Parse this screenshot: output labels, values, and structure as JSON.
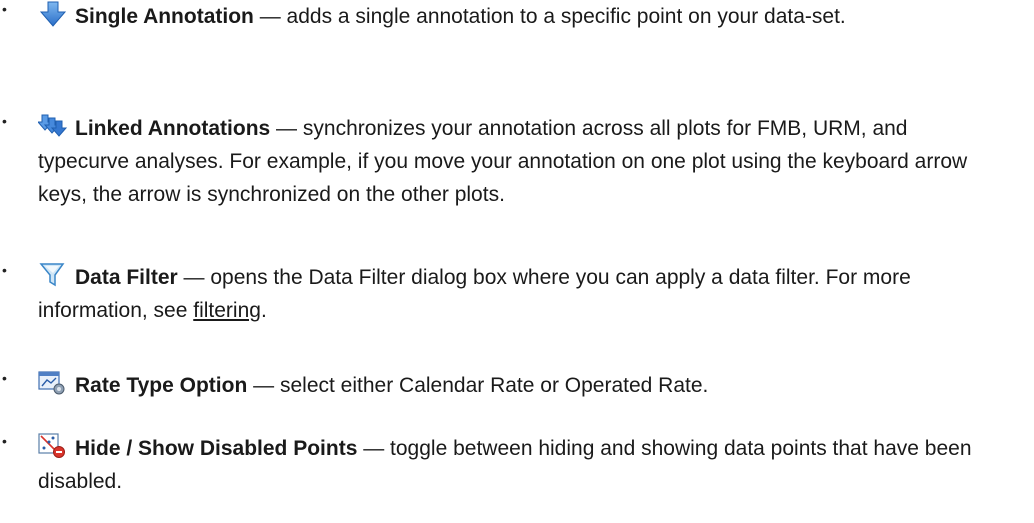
{
  "items": [
    {
      "icon": "down-arrow-icon",
      "term": "Single Annotation",
      "sep": " — ",
      "desc": "adds a single annotation to a specific point on your data-set."
    },
    {
      "icon": "linked-arrows-icon",
      "term": "Linked Annotations",
      "sep": " — ",
      "desc": "synchronizes your annotation across all plots for FMB, URM, and typecurve analyses. For example, if you move your annotation on one plot using the keyboard arrow keys, the arrow is synchronized on the other plots."
    },
    {
      "icon": "funnel-icon",
      "term": "Data Filter",
      "sep": " — ",
      "desc": "opens the Data Filter dialog box where you can apply a data filter. For more information, see ",
      "link": "filtering",
      "tail": "."
    },
    {
      "icon": "rate-type-icon",
      "term": "Rate Type Option",
      "sep": " — ",
      "desc": "select either Calendar Rate or Operated Rate."
    },
    {
      "icon": "hide-show-points-icon",
      "term": "Hide / Show Disabled Points",
      "sep": " — ",
      "desc": "toggle between hiding and showing data points that have been disabled."
    }
  ],
  "colors": {
    "icon_blue": "#3a7fd5",
    "icon_red": "#d9342b",
    "link": "#1a1a1a"
  }
}
